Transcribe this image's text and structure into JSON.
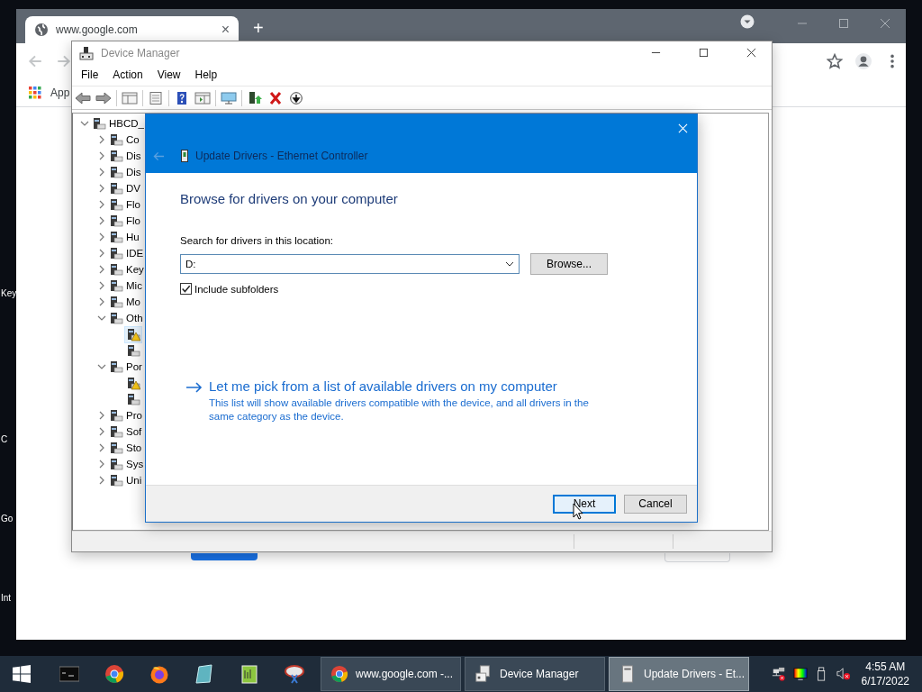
{
  "desktop": {
    "icon_labels": [
      "Key",
      "C",
      "Go",
      "Int"
    ]
  },
  "browser": {
    "tab": {
      "title": "www.google.com",
      "close": "×"
    },
    "new_tab": "+",
    "bookmarks": [
      "App"
    ]
  },
  "device_manager": {
    "title": "Device Manager",
    "menu": [
      "File",
      "Action",
      "View",
      "Help"
    ],
    "tree": {
      "label": "HBCD_",
      "expanded": true,
      "selected": false,
      "children": [
        {
          "label": "Co",
          "expanded": false,
          "selected": false
        },
        {
          "label": "Dis",
          "expanded": false,
          "selected": false
        },
        {
          "label": "Dis",
          "expanded": false,
          "selected": false
        },
        {
          "label": "DV",
          "expanded": false,
          "selected": false
        },
        {
          "label": "Flo",
          "expanded": false,
          "selected": false
        },
        {
          "label": "Flo",
          "expanded": false,
          "selected": false
        },
        {
          "label": "Hu",
          "expanded": false,
          "selected": false
        },
        {
          "label": "IDE",
          "expanded": false,
          "selected": false
        },
        {
          "label": "Key",
          "expanded": false,
          "selected": false
        },
        {
          "label": "Mic",
          "expanded": false,
          "selected": false
        },
        {
          "label": "Mo",
          "expanded": false,
          "selected": false
        },
        {
          "label": "Oth",
          "expanded": true,
          "selected": false,
          "children": [
            {
              "warning": true,
              "selected": true
            },
            {
              "warning": false,
              "selected": false
            }
          ]
        },
        {
          "label": "Por",
          "expanded": true,
          "selected": false,
          "children": [
            {
              "warning": true,
              "selected": false
            },
            {
              "warning": false,
              "selected": false
            }
          ]
        },
        {
          "label": "Pro",
          "expanded": false,
          "selected": false
        },
        {
          "label": "Sof",
          "expanded": false,
          "selected": false
        },
        {
          "label": "Sto",
          "expanded": false,
          "selected": false
        },
        {
          "label": "Sys",
          "expanded": false,
          "selected": false
        },
        {
          "label": "Uni",
          "expanded": false,
          "selected": false
        }
      ]
    }
  },
  "dialog": {
    "title": "Update Drivers - Ethernet Controller",
    "heading": "Browse for drivers on your computer",
    "location_label": "Search for drivers in this location:",
    "location": {
      "value": "D:"
    },
    "browse_button": "Browse...",
    "include_subfolders": {
      "label": "Include subfolders",
      "checked": true
    },
    "link": {
      "text": "Let me pick from a list of available drivers on my computer",
      "description": "This list will show available drivers compatible with the device, and all drivers in the same category as the device."
    },
    "buttons": [
      {
        "label": "Next",
        "default": true
      },
      {
        "label": "Cancel",
        "default": false
      }
    ]
  },
  "taskbar": {
    "tasks": [
      {
        "label": "www.google.com -...",
        "selected": false
      },
      {
        "label": "Device Manager",
        "selected": false
      },
      {
        "label": "Update Drivers - Et...",
        "selected": true
      }
    ],
    "time": "4:55 AM",
    "date": "6/17/2022"
  }
}
